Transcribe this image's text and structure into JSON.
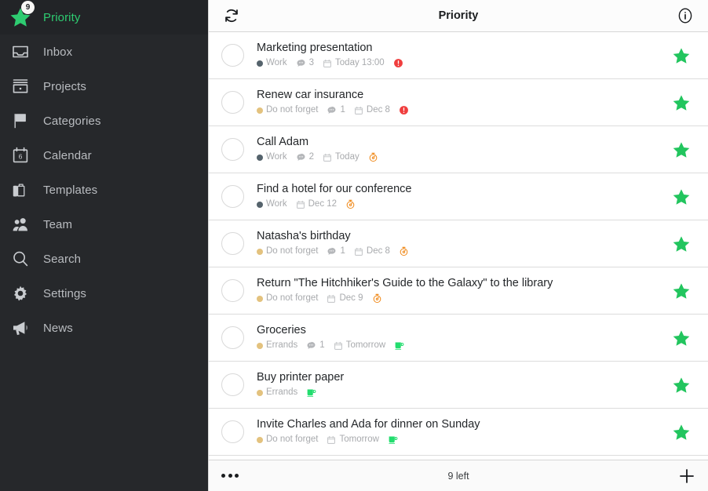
{
  "colors": {
    "sidebar_bg": "#26282b",
    "accent_green": "#22c55e",
    "active_green": "#2ecc71",
    "work_dot": "#55636c",
    "do_not_forget_dot": "#e3c27e",
    "errands_dot": "#e3c27e",
    "alert_red": "#f03e3e",
    "timer_orange": "#f08b1d",
    "note_green": "#22dd6e",
    "meta_text": "#a8aaad"
  },
  "sidebar": {
    "items": [
      {
        "label": "Priority",
        "icon": "star-icon",
        "badge": "9",
        "active": true
      },
      {
        "label": "Inbox",
        "icon": "inbox-icon",
        "badge": null,
        "active": false
      },
      {
        "label": "Projects",
        "icon": "projects-icon",
        "badge": null,
        "active": false
      },
      {
        "label": "Categories",
        "icon": "flag-icon",
        "badge": null,
        "active": false
      },
      {
        "label": "Calendar",
        "icon": "calendar-icon",
        "badge": "6",
        "active": false
      },
      {
        "label": "Templates",
        "icon": "briefcase-icon",
        "badge": null,
        "active": false
      },
      {
        "label": "Team",
        "icon": "people-icon",
        "badge": null,
        "active": false
      },
      {
        "label": "Search",
        "icon": "search-icon",
        "badge": null,
        "active": false
      },
      {
        "label": "Settings",
        "icon": "gear-icon",
        "badge": null,
        "active": false
      },
      {
        "label": "News",
        "icon": "megaphone-icon",
        "badge": null,
        "active": false
      }
    ]
  },
  "header": {
    "title": "Priority",
    "refresh_icon": "sync-icon",
    "info_icon": "info-icon"
  },
  "tasks": [
    {
      "title": "Marketing presentation",
      "category": "Work",
      "category_color": "#55636c",
      "comments": "3",
      "date": "Today 13:00",
      "flag": "alert",
      "starred": true
    },
    {
      "title": "Renew car insurance",
      "category": "Do not forget",
      "category_color": "#e3c27e",
      "comments": "1",
      "date": "Dec 8",
      "flag": "alert",
      "starred": true
    },
    {
      "title": "Call Adam",
      "category": "Work",
      "category_color": "#55636c",
      "comments": "2",
      "date": "Today",
      "flag": "timer",
      "starred": true
    },
    {
      "title": "Find a hotel for our conference",
      "category": "Work",
      "category_color": "#55636c",
      "comments": null,
      "date": "Dec 12",
      "flag": "timer",
      "starred": true
    },
    {
      "title": "Natasha's birthday",
      "category": "Do not forget",
      "category_color": "#e3c27e",
      "comments": "1",
      "date": "Dec 8",
      "flag": "timer",
      "starred": true
    },
    {
      "title": "Return \"The Hitchhiker's Guide to the Galaxy\" to the library",
      "category": "Do not forget",
      "category_color": "#e3c27e",
      "comments": null,
      "date": "Dec 9",
      "flag": "timer",
      "starred": true
    },
    {
      "title": "Groceries",
      "category": "Errands",
      "category_color": "#e3c27e",
      "comments": "1",
      "date": "Tomorrow",
      "flag": "note",
      "starred": true
    },
    {
      "title": "Buy printer paper",
      "category": "Errands",
      "category_color": "#e3c27e",
      "comments": null,
      "date": null,
      "flag": "note",
      "starred": true
    },
    {
      "title": "Invite Charles and Ada for dinner on Sunday",
      "category": "Do not forget",
      "category_color": "#e3c27e",
      "comments": null,
      "date": "Tomorrow",
      "flag": "note",
      "starred": true
    }
  ],
  "footer": {
    "more_icon": "more-dots-icon",
    "count_label": "9 left",
    "add_icon": "plus-icon"
  }
}
